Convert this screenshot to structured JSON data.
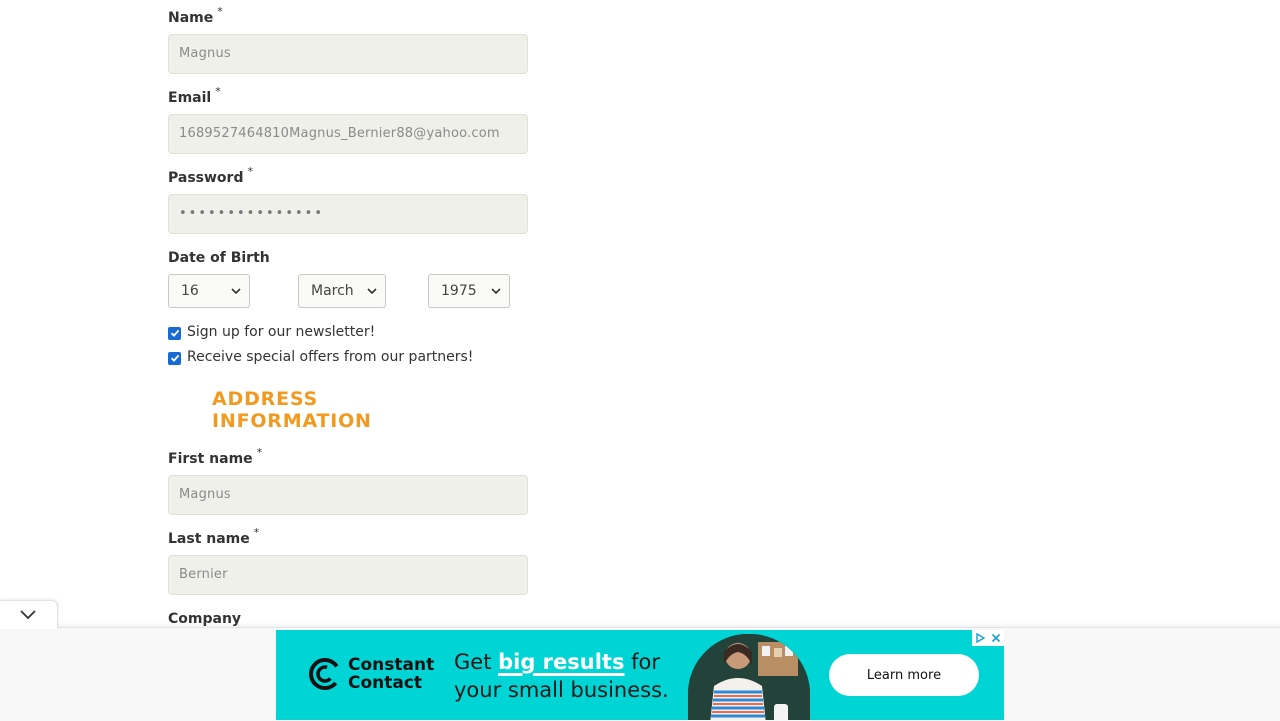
{
  "form": {
    "name": {
      "label": "Name",
      "required": "*",
      "value": "Magnus"
    },
    "email": {
      "label": "Email",
      "required": "*",
      "value": "1689527464810Magnus_Bernier88@yahoo.com"
    },
    "password": {
      "label": "Password",
      "required": "*",
      "value": "•••••••••••••••"
    },
    "dob": {
      "label": "Date of Birth",
      "day": "16",
      "month": "March",
      "year": "1975"
    },
    "newsletter": {
      "label": "Sign up for our newsletter!",
      "checked": true
    },
    "offers": {
      "label": "Receive special offers from our partners!",
      "checked": true
    }
  },
  "address": {
    "heading": "ADDRESS INFORMATION",
    "first_name": {
      "label": "First name",
      "required": "*",
      "value": "Magnus"
    },
    "last_name": {
      "label": "Last name",
      "required": "*",
      "value": "Bernier"
    },
    "company": {
      "label": "Company"
    }
  },
  "ad": {
    "brand_line1": "Constant",
    "brand_line2": "Contact",
    "headline_pre": "Get ",
    "headline_highlight": "big results",
    "headline_post": " for",
    "headline_line2": "your small business.",
    "cta": "Learn more"
  },
  "colors": {
    "accent": "#f29a1f",
    "checkbox": "#1769d6",
    "ad_bg": "#00d4d4"
  }
}
